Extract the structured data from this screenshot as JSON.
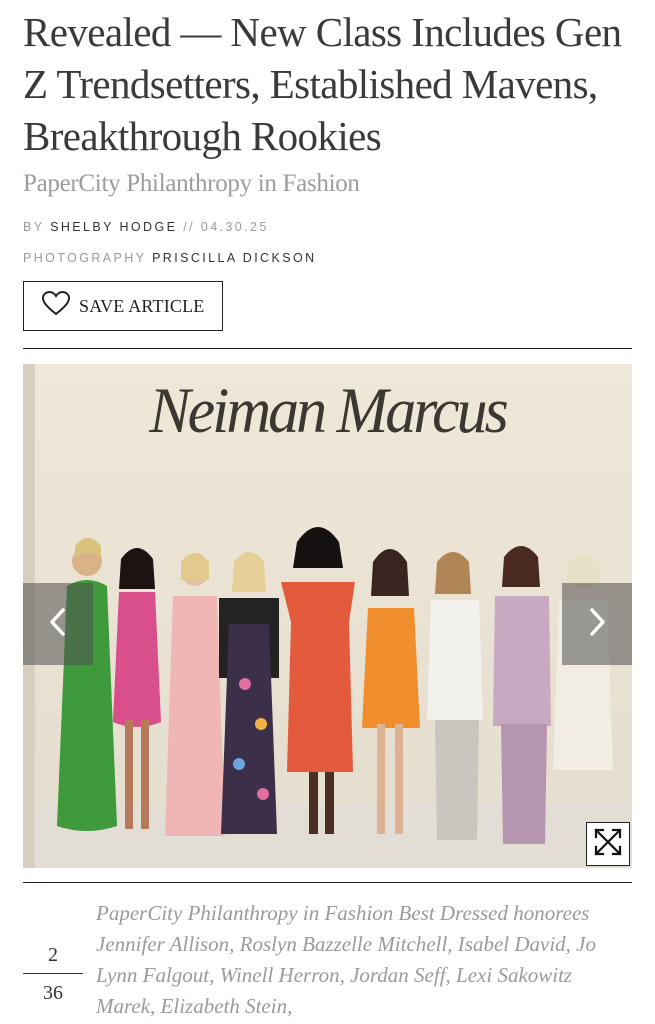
{
  "article": {
    "headline": "Revealed — New Class Includes Gen Z Trendsetters, Established Mavens, Breakthrough Rookies",
    "subhead": "PaperCity Philanthropy in Fashion",
    "byline": {
      "by_label": "BY",
      "author": "SHELBY HODGE",
      "separator": "//",
      "date": "04.30.25"
    },
    "photography": {
      "label": "PHOTOGRAPHY",
      "name": "PRISCILLA DICKSON"
    },
    "save_button_label": "SAVE ARTICLE"
  },
  "gallery": {
    "backdrop_sign": "Neiman Marcus",
    "current": "2",
    "total": "36",
    "caption": "PaperCity Philanthropy in Fashion Best Dressed honorees Jennifer Allison, Roslyn Bazzelle Mitchell, Isabel David, Jo Lynn Falgout, Winell Herron, Jordan Seff, Lexi Sakowitz Marek, Elizabeth Stein,",
    "icons": {
      "prev": "chevron-left-icon",
      "next": "chevron-right-icon",
      "expand": "expand-icon",
      "save": "heart-icon"
    }
  }
}
